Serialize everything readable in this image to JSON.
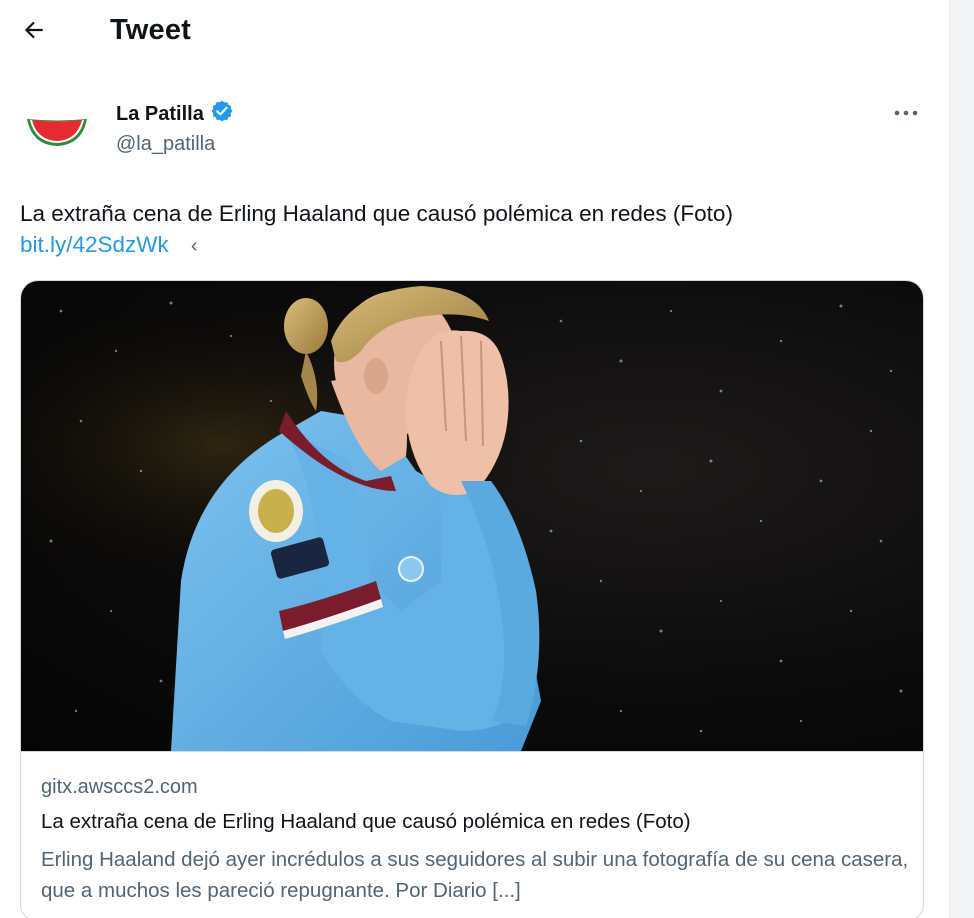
{
  "header": {
    "back_icon": "arrow-left-icon",
    "title": "Tweet"
  },
  "author": {
    "name": "La Patilla",
    "handle": "@la_patilla",
    "verified": true,
    "verified_color": "#1d9bf0",
    "avatar_icon": "watermelon-slice-logo",
    "more_icon": "more-horizontal-icon"
  },
  "tweet": {
    "text": "La extraña cena de Erling Haaland que causó polémica en redes (Foto)",
    "link": "bit.ly/42SdzWk",
    "link_color": "#1d9bf0",
    "trailing_icon": "chevron-left-icon"
  },
  "card": {
    "image_icon": "photo-footballer-covering-face",
    "domain": "gitx.awsccs2.com",
    "title": "La extraña cena de Erling Haaland que causó polémica en redes (Foto)",
    "description": " Erling Haaland dejó ayer incrédulos a sus seguidores al subir una fotografía de su cena casera, que a muchos les pareció repugnante. Por Diario [...]"
  }
}
